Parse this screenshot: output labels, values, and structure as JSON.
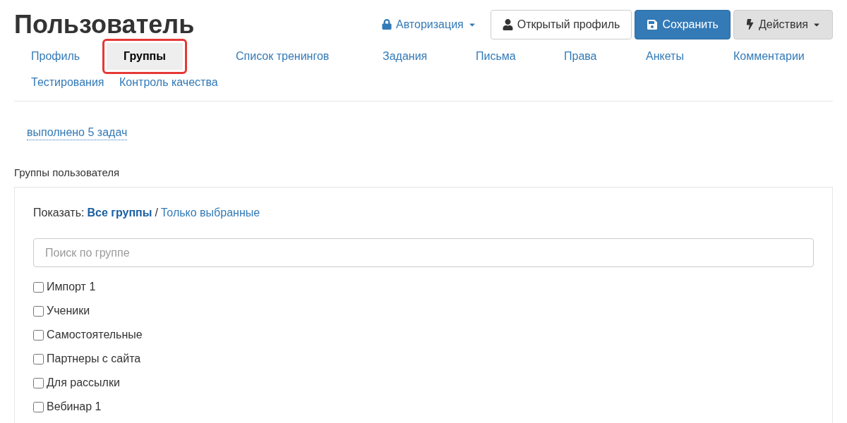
{
  "title": "Пользователь",
  "header_actions": [
    {
      "kind": "dropdown-link",
      "label": "Авторизация"
    },
    {
      "kind": "profile",
      "label": "Открытый профиль"
    },
    {
      "kind": "save",
      "label": "Сохранить"
    },
    {
      "kind": "actions",
      "label": "Действия"
    }
  ],
  "tabs": [
    {
      "label": "Профиль",
      "selected": false
    },
    {
      "label": "Группы",
      "selected": true
    },
    {
      "label": "Список тренингов",
      "selected": false
    },
    {
      "label": "Задания",
      "selected": false
    },
    {
      "label": "Письма",
      "selected": false
    },
    {
      "label": "Права",
      "selected": false
    },
    {
      "label": "Анкеты",
      "selected": false
    },
    {
      "label": "Комментарии",
      "selected": false
    },
    {
      "label": "Тестирования",
      "selected": false
    },
    {
      "label": "Контроль качества",
      "selected": false
    }
  ],
  "tasks_link": "выполнено 5 задач",
  "section_title": "Группы пользователя",
  "filter": {
    "label": "Показать:",
    "options": [
      {
        "label": "Все группы",
        "selected": true
      },
      {
        "label": "Только выбранные",
        "selected": false
      }
    ],
    "separator": "/"
  },
  "search": {
    "placeholder": "Поиск по группе"
  },
  "groups": [
    {
      "label": "Импорт 1",
      "checked": false
    },
    {
      "label": "Ученики",
      "checked": false
    },
    {
      "label": "Самостоятельные",
      "checked": false
    },
    {
      "label": "Партнеры с сайта",
      "checked": false
    },
    {
      "label": "Для рассылки",
      "checked": false
    },
    {
      "label": "Вебинар 1",
      "checked": false
    }
  ]
}
